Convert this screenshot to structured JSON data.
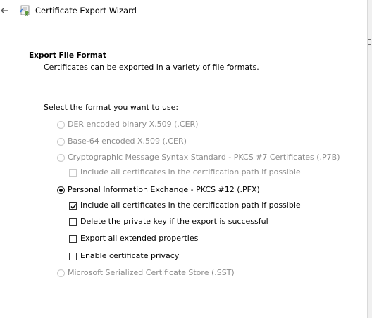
{
  "window": {
    "title": "Certificate Export Wizard",
    "back_icon": "back-arrow-icon",
    "app_icon": "certificate-wizard-icon"
  },
  "header": {
    "heading": "Export File Format",
    "description": "Certificates can be exported in a variety of file formats."
  },
  "form": {
    "prompt": "Select the format you want to use:",
    "options": [
      {
        "label": "DER encoded binary X.509 (.CER)",
        "selected": false,
        "enabled": false
      },
      {
        "label": "Base-64 encoded X.509 (.CER)",
        "selected": false,
        "enabled": false
      },
      {
        "label": "Cryptographic Message Syntax Standard - PKCS #7 Certificates (.P7B)",
        "selected": false,
        "enabled": false
      },
      {
        "label": "Personal Information Exchange - PKCS #12 (.PFX)",
        "selected": true,
        "enabled": true
      },
      {
        "label": "Microsoft Serialized Certificate Store (.SST)",
        "selected": false,
        "enabled": false
      }
    ],
    "p7b_options": [
      {
        "label": "Include all certificates in the certification path if possible",
        "checked": false,
        "enabled": false
      }
    ],
    "pfx_options": [
      {
        "label": "Include all certificates in the certification path if possible",
        "checked": true,
        "enabled": true
      },
      {
        "label": "Delete the private key if the export is successful",
        "checked": false,
        "enabled": true
      },
      {
        "label": "Export all extended properties",
        "checked": false,
        "enabled": true
      },
      {
        "label": "Enable certificate privacy",
        "checked": false,
        "enabled": true
      }
    ]
  }
}
